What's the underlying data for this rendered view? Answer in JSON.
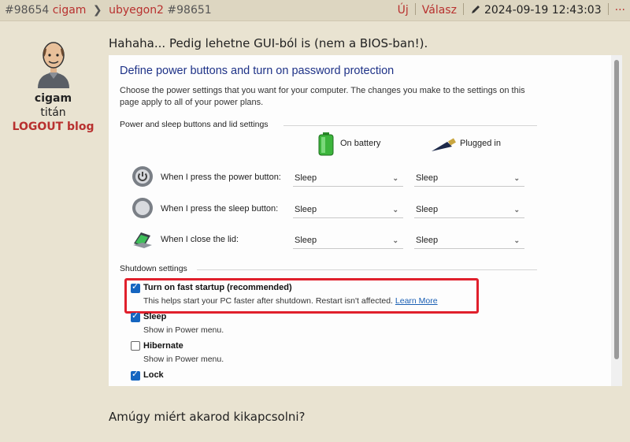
{
  "header": {
    "post_id": "#98654",
    "author": "cigam",
    "reply_to_user": "ubyegon2",
    "reply_to_id": "#98651",
    "new_label": "Új",
    "reply_label": "Válasz",
    "timestamp": "2024-09-19 12:43:03",
    "more_label": "···"
  },
  "author": {
    "name": "cigam",
    "rank": "titán",
    "blog": "LOGOUT blog"
  },
  "post": {
    "text1": "Hahaha... Pedig lehetne GUI-ból is (nem a BIOS-ban!).",
    "text2": "Amúgy miért akarod kikapcsolni?"
  },
  "screenshot": {
    "title": "Define power buttons and turn on password protection",
    "description": "Choose the power settings that you want for your computer. The changes you make to the settings on this page apply to all of your power plans.",
    "group1": "Power and sleep buttons and lid settings",
    "col_battery": "On battery",
    "col_plugged": "Plugged in",
    "rows": [
      {
        "label": "When I press the power button:",
        "battery": "Sleep",
        "plugged": "Sleep"
      },
      {
        "label": "When I press the sleep button:",
        "battery": "Sleep",
        "plugged": "Sleep"
      },
      {
        "label": "When I close the lid:",
        "battery": "Sleep",
        "plugged": "Sleep"
      }
    ],
    "group2": "Shutdown settings",
    "options": [
      {
        "label": "Turn on fast startup (recommended)",
        "desc": "This helps start your PC faster after shutdown. Restart isn't affected.",
        "link": "Learn More",
        "checked": true
      },
      {
        "label": "Sleep",
        "desc": "Show in Power menu.",
        "checked": true
      },
      {
        "label": "Hibernate",
        "desc": "Show in Power menu.",
        "checked": false
      },
      {
        "label": "Lock",
        "checked": true
      }
    ]
  },
  "colors": {
    "accent_red": "#b8312f",
    "background": "#e9e3d1",
    "highlight_box": "#e0202c",
    "checkbox_blue": "#1565c0"
  }
}
